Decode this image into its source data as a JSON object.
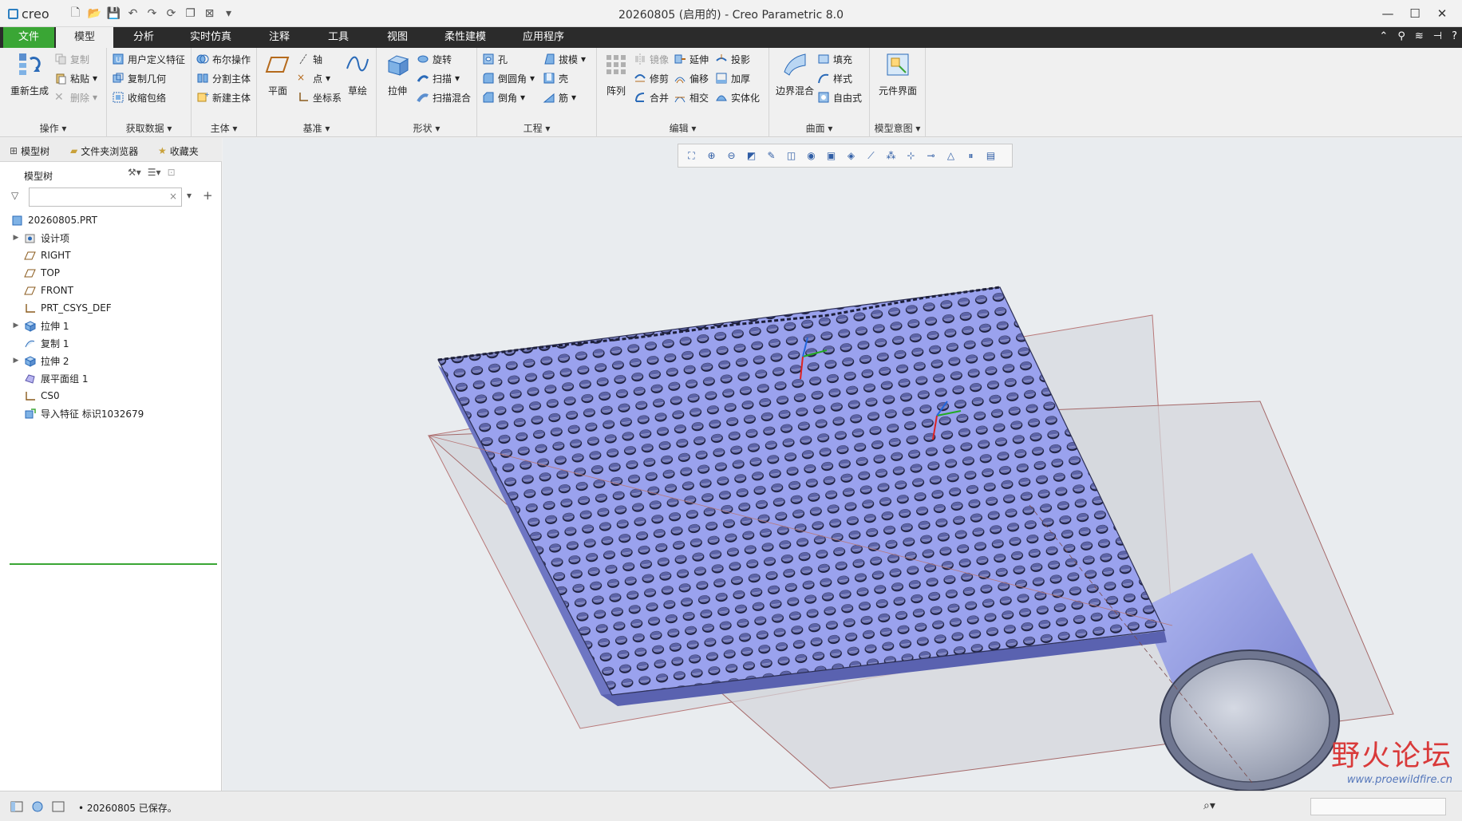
{
  "app": {
    "logo_text": "creo",
    "window_title": "20260805 (启用的) - Creo Parametric 8.0"
  },
  "quick_access": [
    "new-icon",
    "open-icon",
    "save-icon",
    "undo-icon",
    "redo-icon",
    "regenerate-icon",
    "windows-icon",
    "close-window-icon",
    "customize-icon"
  ],
  "tabs": {
    "file": "文件",
    "model": "模型",
    "analysis": "分析",
    "simulation": "实时仿真",
    "annotate": "注释",
    "tools": "工具",
    "view": "视图",
    "flexible": "柔性建模",
    "apps": "应用程序"
  },
  "ribbon": {
    "operations": {
      "label": "操作",
      "regenerate": "重新生成",
      "copy": "复制",
      "paste": "粘贴",
      "delete": "删除"
    },
    "get_data": {
      "label": "获取数据",
      "udf": "用户定义特征",
      "copy_geom": "复制几何",
      "shrinkwrap": "收缩包络"
    },
    "body": {
      "label": "主体",
      "boolean": "布尔操作",
      "split": "分割主体",
      "new_body": "新建主体"
    },
    "datum": {
      "label": "基准",
      "plane": "平面",
      "axis": "轴",
      "point": "点",
      "csys": "坐标系",
      "sketch": "草绘"
    },
    "shapes": {
      "label": "形状",
      "extrude": "拉伸",
      "revolve": "旋转",
      "sweep": "扫描",
      "swept_blend": "扫描混合"
    },
    "engineering": {
      "label": "工程",
      "hole": "孔",
      "draft": "拔模",
      "round": "倒圆角",
      "shell": "壳",
      "chamfer": "倒角",
      "rib": "筋"
    },
    "editing": {
      "label": "编辑",
      "pattern": "阵列",
      "mirror": "镜像",
      "extend": "延伸",
      "project": "投影",
      "trim": "修剪",
      "offset": "偏移",
      "thicken": "加厚",
      "merge": "合并",
      "intersect": "相交",
      "solidify": "实体化"
    },
    "surfaces": {
      "label": "曲面",
      "boundary_blend": "边界混合",
      "fill": "填充",
      "style": "样式",
      "freestyle": "自由式"
    },
    "model_intent": {
      "label": "模型意图",
      "component_interface": "元件界面"
    }
  },
  "left_panel": {
    "tabs": {
      "model_tree": "模型树",
      "folder_browser": "文件夹浏览器",
      "favorites": "收藏夹"
    },
    "tree_title": "模型树",
    "search_value": "",
    "items": [
      {
        "label": "20260805.PRT",
        "icon": "part-icon",
        "expand": ""
      },
      {
        "label": "设计项",
        "icon": "design-items-icon",
        "expand": "▶"
      },
      {
        "label": "RIGHT",
        "icon": "datum-plane-icon",
        "expand": ""
      },
      {
        "label": "TOP",
        "icon": "datum-plane-icon",
        "expand": ""
      },
      {
        "label": "FRONT",
        "icon": "datum-plane-icon",
        "expand": ""
      },
      {
        "label": "PRT_CSYS_DEF",
        "icon": "csys-icon",
        "expand": ""
      },
      {
        "label": "拉伸 1",
        "icon": "extrude-icon",
        "expand": "▶"
      },
      {
        "label": "复制 1",
        "icon": "copy-feature-icon",
        "expand": ""
      },
      {
        "label": "拉伸 2",
        "icon": "extrude-icon",
        "expand": "▶"
      },
      {
        "label": "展平面组 1",
        "icon": "flatten-quilt-icon",
        "expand": ""
      },
      {
        "label": "CS0",
        "icon": "csys-icon",
        "expand": ""
      },
      {
        "label": "导入特征 标识1032679",
        "icon": "import-feature-icon",
        "expand": ""
      }
    ]
  },
  "status": {
    "message": "• 20260805 已保存。"
  },
  "watermark": {
    "cn": "野火论坛",
    "url": "www.proewildfire.cn"
  },
  "colors": {
    "accent": "#3aa635",
    "model": "#9aa2ee",
    "tabbar": "#2b2b2b"
  }
}
